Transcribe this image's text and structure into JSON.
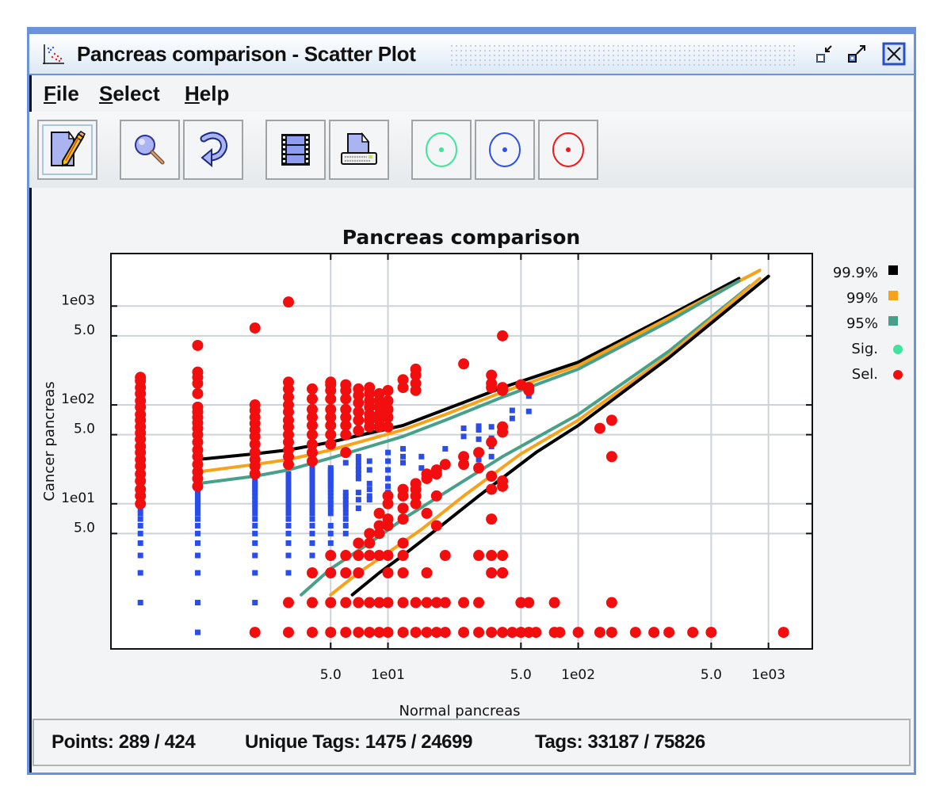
{
  "window": {
    "title": "Pancreas comparison - Scatter Plot",
    "controls": [
      "minimize",
      "maximize",
      "close"
    ]
  },
  "menu": {
    "items": [
      {
        "label": "File",
        "mnemonic": "F",
        "rest": "ile"
      },
      {
        "label": "Select",
        "mnemonic": "S",
        "rest": "elect"
      },
      {
        "label": "Help",
        "mnemonic": "H",
        "rest": "elp"
      }
    ]
  },
  "toolbar": {
    "buttons": [
      {
        "name": "edit",
        "icon": "edit-pencil-icon",
        "active": true
      },
      {
        "name": "zoom",
        "icon": "magnifier-icon"
      },
      {
        "name": "reset",
        "icon": "refresh-arrow-icon"
      },
      {
        "name": "filmstrip",
        "icon": "filmstrip-icon"
      },
      {
        "name": "print",
        "icon": "printer-icon"
      },
      {
        "name": "select-significant",
        "icon": "target-green-icon",
        "color": "#3fe39a"
      },
      {
        "name": "select-blue",
        "icon": "target-blue-icon",
        "color": "#2f4fe6"
      },
      {
        "name": "select-red",
        "icon": "target-red-icon",
        "color": "#f01818"
      }
    ]
  },
  "status": {
    "points": "Points: 289 / 424",
    "unique_tags": "Unique Tags: 1475 / 24699",
    "tags": "Tags: 33187 / 75826"
  },
  "colors": {
    "line_999": "#000000",
    "line_99": "#f7a21b",
    "line_95": "#46a08a",
    "sig": "#3fe39a",
    "sel": "#f20e0e",
    "unsel": "#2a4de8",
    "grid": "#cdd3d8"
  },
  "chart_data": {
    "type": "scatter",
    "title": "Pancreas comparison",
    "xlabel": "Normal pancreas",
    "ylabel": "Cancer pancreas",
    "xscale": "log",
    "yscale": "log",
    "xlim": [
      0.35,
      1700
    ],
    "ylim": [
      0.34,
      3400
    ],
    "grid": true,
    "x_ticks": [
      {
        "value": 5,
        "label": "5.0"
      },
      {
        "value": 10,
        "label": "1e01"
      },
      {
        "value": 50,
        "label": "5.0"
      },
      {
        "value": 100,
        "label": "1e02"
      },
      {
        "value": 500,
        "label": "5.0"
      },
      {
        "value": 1000,
        "label": "1e03"
      }
    ],
    "y_ticks": [
      {
        "value": 1000,
        "label": "1e03"
      },
      {
        "value": 500,
        "label": "5.0"
      },
      {
        "value": 100,
        "label": "1e02"
      },
      {
        "value": 50,
        "label": "5.0"
      },
      {
        "value": 10,
        "label": "1e01"
      },
      {
        "value": 5,
        "label": "5.0"
      }
    ],
    "legend": {
      "placement": "right",
      "entries": [
        {
          "label": "99.9%",
          "marker": "square",
          "color": "#000000"
        },
        {
          "label": "99%",
          "marker": "square",
          "color": "#f7a21b"
        },
        {
          "label": "95%",
          "marker": "square",
          "color": "#46a08a"
        },
        {
          "label": "Sig.",
          "marker": "circle",
          "color": "#3fe39a"
        },
        {
          "label": "Sel.",
          "marker": "circle",
          "color": "#f20e0e"
        }
      ]
    },
    "curves": [
      {
        "name": "99.9% upper",
        "color": "#000000",
        "points": [
          [
            1,
            28
          ],
          [
            2,
            32
          ],
          [
            3,
            35
          ],
          [
            5,
            42
          ],
          [
            8,
            52
          ],
          [
            12,
            62
          ],
          [
            20,
            90
          ],
          [
            40,
            150
          ],
          [
            100,
            270
          ],
          [
            300,
            800
          ],
          [
            700,
            1900
          ]
        ]
      },
      {
        "name": "99% upper",
        "color": "#f7a21b",
        "points": [
          [
            1,
            21
          ],
          [
            2,
            25
          ],
          [
            3,
            28
          ],
          [
            5,
            35
          ],
          [
            8,
            45
          ],
          [
            12,
            56
          ],
          [
            20,
            80
          ],
          [
            40,
            135
          ],
          [
            100,
            250
          ],
          [
            300,
            760
          ],
          [
            900,
            2300
          ]
        ]
      },
      {
        "name": "95% upper",
        "color": "#46a08a",
        "points": [
          [
            1,
            16
          ],
          [
            2,
            19
          ],
          [
            3,
            22
          ],
          [
            5,
            29
          ],
          [
            8,
            38
          ],
          [
            12,
            48
          ],
          [
            20,
            70
          ],
          [
            40,
            120
          ],
          [
            100,
            230
          ],
          [
            300,
            700
          ],
          [
            700,
            1800
          ]
        ]
      },
      {
        "name": "95% lower",
        "color": "#46a08a",
        "points": [
          [
            3.5,
            1.2
          ],
          [
            5,
            2.2
          ],
          [
            8,
            4
          ],
          [
            12,
            7
          ],
          [
            20,
            13
          ],
          [
            40,
            30
          ],
          [
            100,
            80
          ],
          [
            300,
            350
          ],
          [
            800,
            1600
          ]
        ]
      },
      {
        "name": "99% lower",
        "color": "#f7a21b",
        "points": [
          [
            5,
            1.2
          ],
          [
            7,
            2
          ],
          [
            10,
            3.2
          ],
          [
            15,
            5.5
          ],
          [
            25,
            12
          ],
          [
            50,
            32
          ],
          [
            100,
            70
          ],
          [
            300,
            320
          ],
          [
            900,
            1900
          ]
        ]
      },
      {
        "name": "99.9% lower",
        "color": "#000000",
        "points": [
          [
            6.5,
            1.2
          ],
          [
            9,
            2
          ],
          [
            12,
            3
          ],
          [
            18,
            5.5
          ],
          [
            30,
            12
          ],
          [
            60,
            33
          ],
          [
            100,
            62
          ],
          [
            300,
            300
          ],
          [
            1000,
            2000
          ]
        ]
      }
    ],
    "series": [
      {
        "name": "Unselected",
        "color": "#2a4de8",
        "marker": "square",
        "columns": [
          {
            "x": 0.5,
            "y_values": [
              1,
              2,
              3,
              4,
              5,
              6,
              7,
              8,
              9
            ]
          },
          {
            "x": 1,
            "y_values": [
              0.5,
              1,
              2,
              3,
              4,
              5,
              6,
              7,
              8,
              9,
              10,
              11,
              12,
              13,
              14,
              15
            ]
          },
          {
            "x": 2,
            "y_values": [
              1,
              2,
              3,
              4,
              5,
              6,
              7,
              8,
              9,
              10,
              11,
              12,
              13,
              14,
              15,
              16,
              17
            ]
          },
          {
            "x": 3,
            "y_values": [
              1,
              2,
              3,
              4,
              5,
              6,
              7,
              8,
              9,
              10,
              11,
              12,
              13,
              14,
              15,
              16,
              17,
              18,
              19,
              20
            ]
          },
          {
            "x": 4,
            "y_values": [
              3,
              4,
              5,
              6,
              7,
              8,
              9,
              10,
              11,
              12,
              13,
              14,
              15,
              16,
              17,
              18,
              19,
              20,
              21,
              22,
              23,
              24,
              25,
              26
            ]
          },
          {
            "x": 5,
            "y_values": [
              4,
              5,
              6,
              8,
              9,
              10,
              11,
              12,
              13,
              14,
              15,
              16,
              17,
              18,
              19,
              20,
              21,
              22,
              23
            ]
          },
          {
            "x": 6,
            "y_values": [
              5,
              6,
              7,
              8,
              9,
              10,
              11,
              12,
              13,
              26
            ]
          },
          {
            "x": 7,
            "y_values": [
              9,
              11,
              13,
              18,
              20,
              22,
              24,
              27,
              30
            ]
          },
          {
            "x": 8,
            "y_values": [
              11,
              12,
              14,
              16,
              22,
              27
            ]
          },
          {
            "x": 10,
            "y_values": [
              13,
              15,
              18,
              22,
              27,
              33
            ]
          },
          {
            "x": 12,
            "y_values": [
              26,
              30,
              36
            ]
          },
          {
            "x": 15,
            "y_values": [
              23,
              30
            ]
          },
          {
            "x": 20,
            "y_values": [
              36
            ]
          },
          {
            "x": 25,
            "y_values": [
              48,
              58
            ]
          },
          {
            "x": 30,
            "y_values": [
              28,
              45,
              56,
              61
            ]
          },
          {
            "x": 35,
            "y_values": [
              30,
              38,
              46,
              60
            ]
          },
          {
            "x": 45,
            "y_values": [
              73,
              88
            ]
          },
          {
            "x": 55,
            "y_values": [
              86,
              123
            ]
          }
        ]
      },
      {
        "name": "Sel.",
        "color": "#f20e0e",
        "marker": "circle",
        "columns": [
          {
            "x": 0.5,
            "y_values": [
              10,
              12,
              14,
              17,
              20,
              24,
              28,
              33,
              38,
              45,
              52,
              60,
              70,
              80,
              95,
              110,
              130,
              150,
              175,
              190
            ]
          },
          {
            "x": 1,
            "y_values": [
              15,
              18,
              21,
              25,
              30,
              35,
              42,
              50,
              58,
              66,
              75,
              85,
              95,
              130,
              165,
              190,
              215,
              400
            ]
          },
          {
            "x": 2,
            "y_values": [
              20,
              24,
              28,
              33,
              40,
              48,
              56,
              65,
              75,
              88,
              100,
              600
            ]
          },
          {
            "x": 2,
            "y_values": [
              0.5
            ]
          },
          {
            "x": 3,
            "y_values": [
              0.5,
              1,
              25,
              30,
              35,
              42,
              50,
              60,
              70,
              85,
              100,
              120,
              145,
              170,
              1100
            ]
          },
          {
            "x": 4,
            "y_values": [
              0.5,
              1,
              2,
              27,
              33,
              40,
              50,
              62,
              75,
              90,
              115,
              145
            ]
          },
          {
            "x": 5,
            "y_values": [
              0.5,
              1,
              2,
              3,
              40,
              50,
              62,
              75,
              90,
              115,
              140,
              160,
              170
            ]
          },
          {
            "x": 6,
            "y_values": [
              0.5,
              1,
              2,
              3,
              33,
              50,
              62,
              75,
              90,
              115,
              140,
              160
            ]
          },
          {
            "x": 7,
            "y_values": [
              0.5,
              1,
              2,
              3,
              4,
              55,
              70,
              85,
              105,
              125,
              145
            ]
          },
          {
            "x": 8,
            "y_values": [
              0.5,
              1,
              3,
              4,
              5,
              60,
              70,
              80,
              95,
              110,
              130,
              150
            ]
          },
          {
            "x": 9,
            "y_values": [
              0.5,
              1,
              3,
              5,
              6,
              8,
              60,
              70,
              80,
              95,
              110,
              130
            ]
          },
          {
            "x": 10,
            "y_values": [
              0.5,
              1,
              2,
              3,
              6,
              7,
              10,
              12,
              60,
              75,
              90,
              110,
              140
            ]
          },
          {
            "x": 12,
            "y_values": [
              0.5,
              1,
              2,
              3,
              4,
              7,
              9,
              12,
              14,
              150,
              180
            ]
          },
          {
            "x": 14,
            "y_values": [
              0.5,
              1,
              10,
              12,
              14,
              16,
              140,
              165,
              200,
              230
            ]
          },
          {
            "x": 16,
            "y_values": [
              0.5,
              1,
              2,
              8,
              18,
              20
            ]
          },
          {
            "x": 18,
            "y_values": [
              0.5,
              1,
              6,
              12,
              20,
              22
            ]
          },
          {
            "x": 20,
            "y_values": [
              0.5,
              1,
              3,
              25
            ]
          },
          {
            "x": 25,
            "y_values": [
              0.5,
              1,
              25,
              30,
              260
            ]
          },
          {
            "x": 30,
            "y_values": [
              0.5,
              1,
              3,
              23,
              33
            ]
          },
          {
            "x": 35,
            "y_values": [
              0.5,
              2,
              3,
              7,
              14,
              19,
              42,
              150,
              165,
              200
            ]
          },
          {
            "x": 40,
            "y_values": [
              0.5,
              2,
              2,
              3,
              15,
              17,
              53,
              60,
              140,
              150,
              500
            ]
          },
          {
            "x": 45,
            "y_values": [
              0.5
            ]
          },
          {
            "x": 50,
            "y_values": [
              0.5,
              1,
              160
            ]
          },
          {
            "x": 55,
            "y_values": [
              0.5,
              1,
              150,
              140
            ]
          },
          {
            "x": 60,
            "y_values": [
              0.5
            ]
          },
          {
            "x": 75,
            "y_values": [
              0.5,
              1
            ]
          },
          {
            "x": 80,
            "y_values": [
              0.5
            ]
          },
          {
            "x": 100,
            "y_values": [
              0.5
            ]
          },
          {
            "x": 130,
            "y_values": [
              0.5,
              58
            ]
          },
          {
            "x": 150,
            "y_values": [
              0.5,
              1,
              70,
              30
            ]
          },
          {
            "x": 200,
            "y_values": [
              0.5
            ]
          },
          {
            "x": 250,
            "y_values": [
              0.5
            ]
          },
          {
            "x": 300,
            "y_values": [
              0.5
            ]
          },
          {
            "x": 400,
            "y_values": [
              0.5
            ]
          },
          {
            "x": 500,
            "y_values": [
              0.5
            ]
          },
          {
            "x": 1200,
            "y_values": [
              0.5
            ]
          }
        ]
      }
    ]
  }
}
